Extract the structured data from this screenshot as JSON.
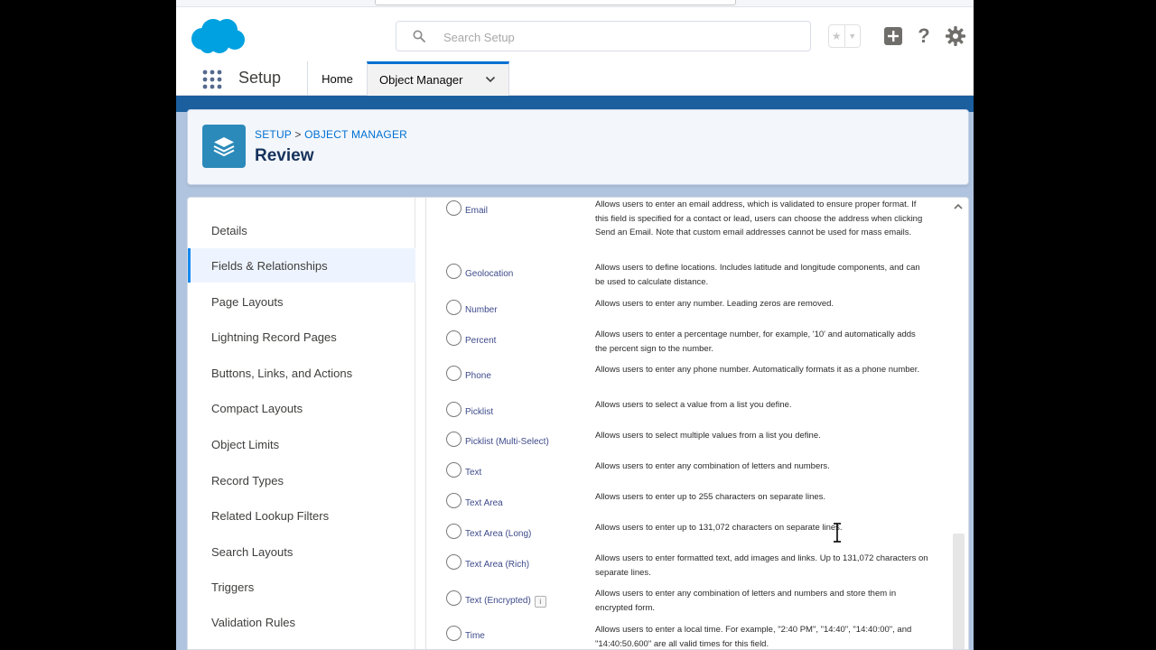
{
  "header": {
    "search_placeholder": "Search Setup",
    "help_glyph": "?"
  },
  "nav": {
    "app_name": "Setup",
    "home": "Home",
    "object_manager": "Object Manager"
  },
  "page": {
    "breadcrumb_setup": "SETUP",
    "breadcrumb_sep": ">",
    "breadcrumb_object_manager": "OBJECT MANAGER",
    "title": "Review"
  },
  "sidebar": {
    "items": [
      {
        "label": "Details"
      },
      {
        "label": "Fields & Relationships"
      },
      {
        "label": "Page Layouts"
      },
      {
        "label": "Lightning Record Pages"
      },
      {
        "label": "Buttons, Links, and Actions"
      },
      {
        "label": "Compact Layouts"
      },
      {
        "label": "Object Limits"
      },
      {
        "label": "Record Types"
      },
      {
        "label": "Related Lookup Filters"
      },
      {
        "label": "Search Layouts"
      },
      {
        "label": "Triggers"
      },
      {
        "label": "Validation Rules"
      }
    ],
    "active_index": 1
  },
  "field_types": [
    {
      "type": "Email",
      "desc": "Allows users to enter an email address, which is validated to ensure proper format. If this field is specified for a contact or lead, users can choose the address when clicking Send an Email. Note that custom email addresses cannot be used for mass emails."
    },
    {
      "type": "Geolocation",
      "desc": "Allows users to define locations. Includes latitude and longitude components, and can be used to calculate distance."
    },
    {
      "type": "Number",
      "desc": "Allows users to enter any number. Leading zeros are removed."
    },
    {
      "type": "Percent",
      "desc": "Allows users to enter a percentage number, for example, '10' and automatically adds the percent sign to the number."
    },
    {
      "type": "Phone",
      "desc": "Allows users to enter any phone number. Automatically formats it as a phone number."
    },
    {
      "type": "Picklist",
      "desc": "Allows users to select a value from a list you define."
    },
    {
      "type": "Picklist (Multi-Select)",
      "desc": "Allows users to select multiple values from a list you define."
    },
    {
      "type": "Text",
      "desc": "Allows users to enter any combination of letters and numbers."
    },
    {
      "type": "Text Area",
      "desc": "Allows users to enter up to 255 characters on separate lines."
    },
    {
      "type": "Text Area (Long)",
      "desc": "Allows users to enter up to 131,072 characters on separate lines."
    },
    {
      "type": "Text Area (Rich)",
      "desc": "Allows users to enter formatted text, add images and links. Up to 131,072 characters on separate lines."
    },
    {
      "type": "Text (Encrypted)",
      "desc": "Allows users to enter any combination of letters and numbers and store them in encrypted form.",
      "info": "i"
    },
    {
      "type": "Time",
      "desc": "Allows users to enter a local time. For example, \"2:40 PM\", \"14:40\", \"14:40:00\", and \"14:40:50.600\" are all valid times for this field."
    }
  ],
  "colors": {
    "brand_blue": "#0070d2",
    "page_band": "#b0c4df",
    "object_icon": "#2c8aba",
    "logo": "#00a1e0"
  }
}
